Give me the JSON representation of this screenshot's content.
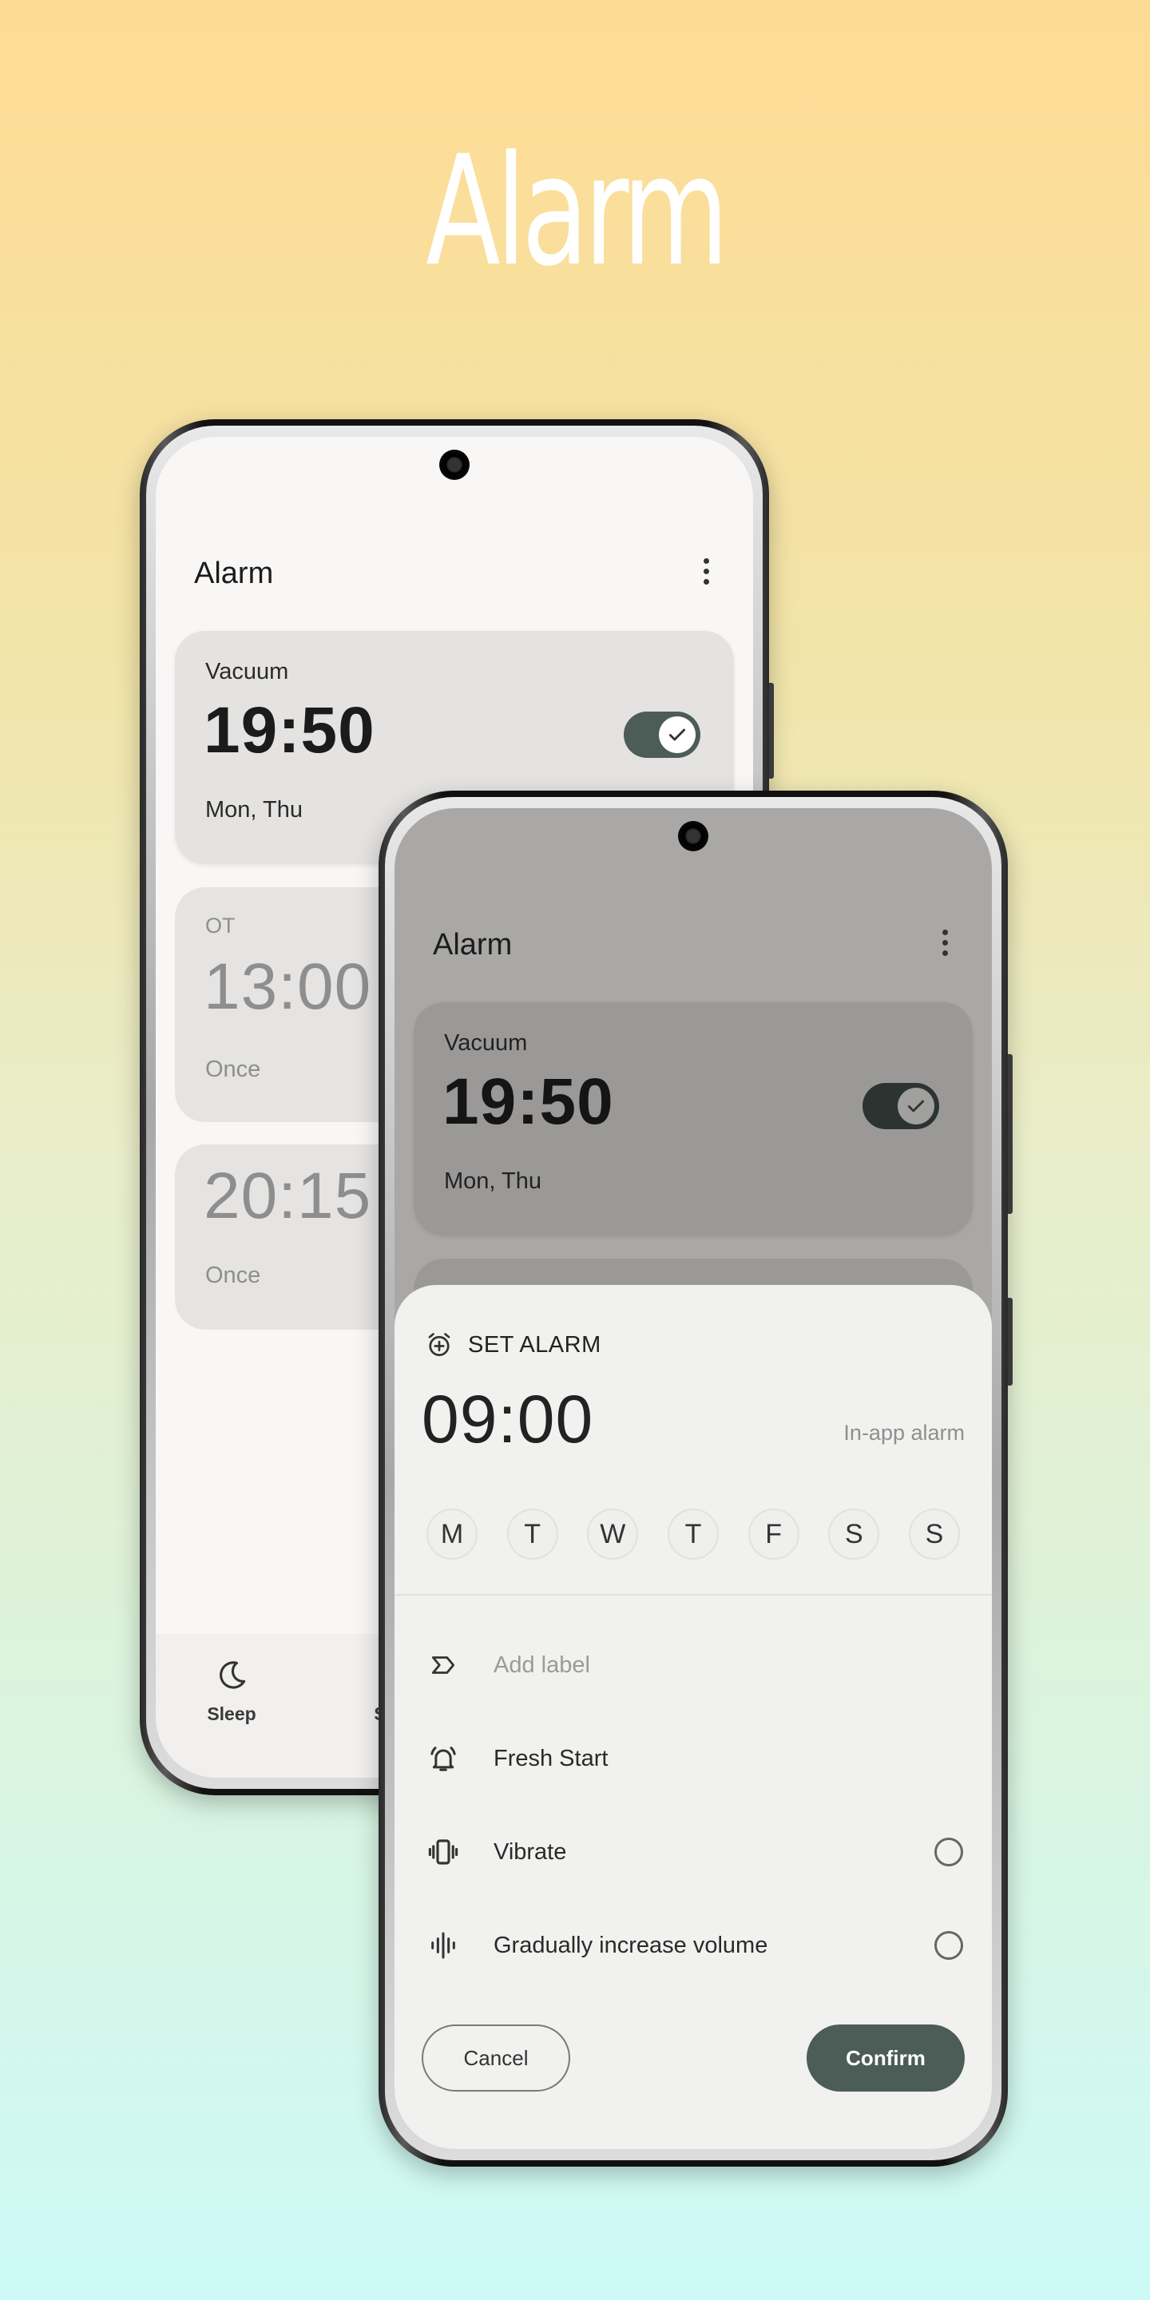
{
  "hero_title": "Alarm",
  "colors": {
    "accent": "#4c5c57",
    "sheet_bg": "#f1f1ef",
    "card_bg": "#e5e4e2"
  },
  "back_phone": {
    "app_title": "Alarm",
    "alarms": [
      {
        "label": "Vacuum",
        "time": "19:50",
        "days": "Mon, Thu",
        "enabled": true
      },
      {
        "label": "OT",
        "time": "13:00",
        "days": "Once",
        "enabled": false
      },
      {
        "label": "",
        "time": "20:15",
        "days": "Once",
        "enabled": false
      }
    ],
    "nav": [
      {
        "icon": "moon-icon",
        "label": "Sleep"
      },
      {
        "icon": "sound-icon",
        "label": "Sou"
      }
    ]
  },
  "front_phone": {
    "app_title": "Alarm",
    "alarm": {
      "label": "Vacuum",
      "time": "19:50",
      "days": "Mon, Thu",
      "enabled": true
    },
    "sheet": {
      "title": "SET ALARM",
      "time": "09:00",
      "mode": "In-app alarm",
      "days": [
        "M",
        "T",
        "W",
        "T",
        "F",
        "S",
        "S"
      ],
      "label_placeholder": "Add label",
      "ringtone": "Fresh Start",
      "vibrate": "Vibrate",
      "vibrate_on": false,
      "gradual": "Gradually increase volume",
      "gradual_on": false,
      "cancel": "Cancel",
      "confirm": "Confirm"
    }
  }
}
